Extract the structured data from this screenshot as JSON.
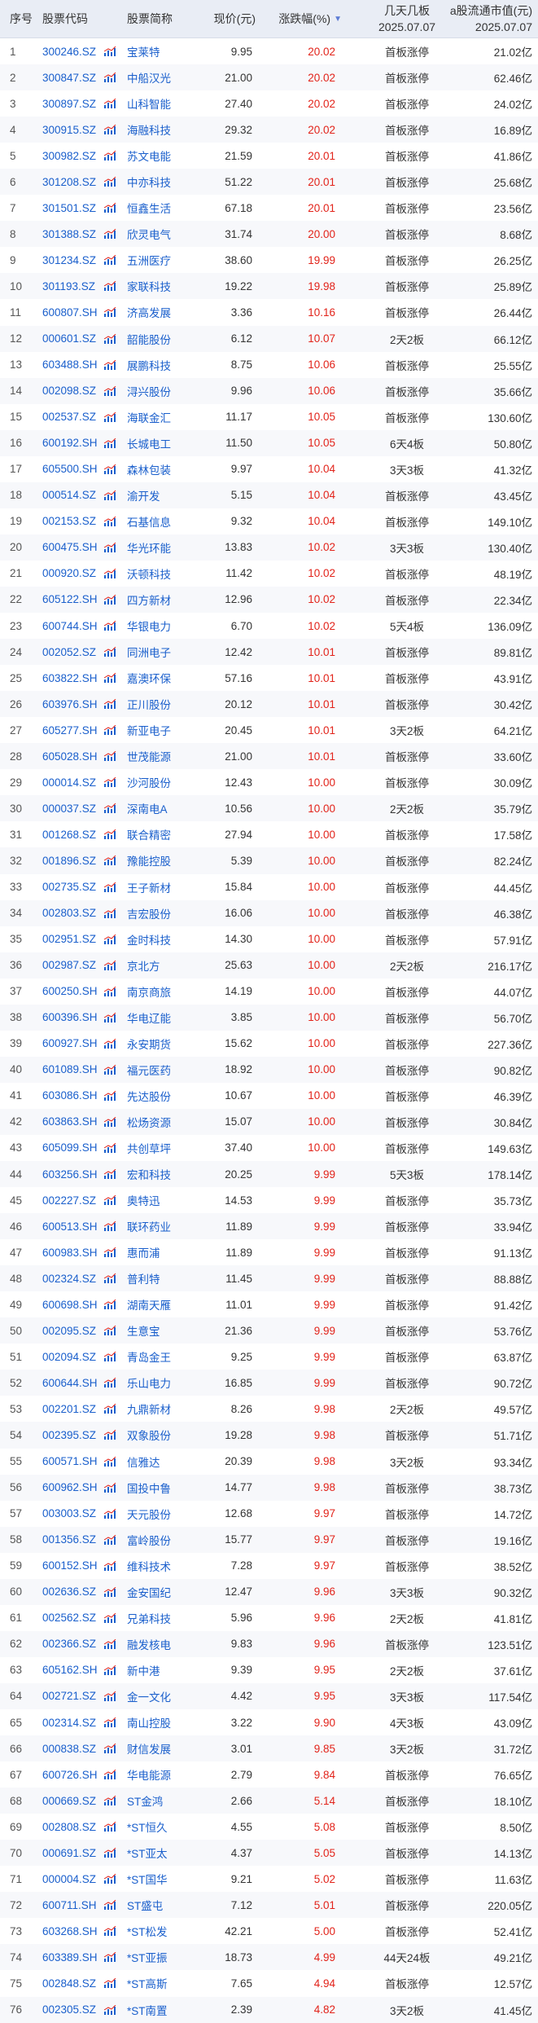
{
  "header": {
    "idx": "序号",
    "code": "股票代码",
    "name": "股票简称",
    "price": "现价(元)",
    "change": "涨跌幅(%)",
    "sort_icon": "▼",
    "board": "几天几板",
    "board_date": "2025.07.07",
    "cap": "a股流通市值(元)",
    "cap_date": "2025.07.07"
  },
  "colors": {
    "header_bg": "#e9edf5",
    "link_blue": "#1a5fcc",
    "up_red": "#e2231a"
  },
  "rows": [
    {
      "idx": "1",
      "code": "300246.SZ",
      "name": "宝莱特",
      "price": "9.95",
      "change": "20.02",
      "board": "首板涨停",
      "cap": "21.02亿"
    },
    {
      "idx": "2",
      "code": "300847.SZ",
      "name": "中船汉光",
      "price": "21.00",
      "change": "20.02",
      "board": "首板涨停",
      "cap": "62.46亿"
    },
    {
      "idx": "3",
      "code": "300897.SZ",
      "name": "山科智能",
      "price": "27.40",
      "change": "20.02",
      "board": "首板涨停",
      "cap": "24.02亿"
    },
    {
      "idx": "4",
      "code": "300915.SZ",
      "name": "海融科技",
      "price": "29.32",
      "change": "20.02",
      "board": "首板涨停",
      "cap": "16.89亿"
    },
    {
      "idx": "5",
      "code": "300982.SZ",
      "name": "苏文电能",
      "price": "21.59",
      "change": "20.01",
      "board": "首板涨停",
      "cap": "41.86亿"
    },
    {
      "idx": "6",
      "code": "301208.SZ",
      "name": "中亦科技",
      "price": "51.22",
      "change": "20.01",
      "board": "首板涨停",
      "cap": "25.68亿"
    },
    {
      "idx": "7",
      "code": "301501.SZ",
      "name": "恒鑫生活",
      "price": "67.18",
      "change": "20.01",
      "board": "首板涨停",
      "cap": "23.56亿"
    },
    {
      "idx": "8",
      "code": "301388.SZ",
      "name": "欣灵电气",
      "price": "31.74",
      "change": "20.00",
      "board": "首板涨停",
      "cap": "8.68亿"
    },
    {
      "idx": "9",
      "code": "301234.SZ",
      "name": "五洲医疗",
      "price": "38.60",
      "change": "19.99",
      "board": "首板涨停",
      "cap": "26.25亿"
    },
    {
      "idx": "10",
      "code": "301193.SZ",
      "name": "家联科技",
      "price": "19.22",
      "change": "19.98",
      "board": "首板涨停",
      "cap": "25.89亿"
    },
    {
      "idx": "11",
      "code": "600807.SH",
      "name": "济高发展",
      "price": "3.36",
      "change": "10.16",
      "board": "首板涨停",
      "cap": "26.44亿"
    },
    {
      "idx": "12",
      "code": "000601.SZ",
      "name": "韶能股份",
      "price": "6.12",
      "change": "10.07",
      "board": "2天2板",
      "cap": "66.12亿"
    },
    {
      "idx": "13",
      "code": "603488.SH",
      "name": "展鹏科技",
      "price": "8.75",
      "change": "10.06",
      "board": "首板涨停",
      "cap": "25.55亿"
    },
    {
      "idx": "14",
      "code": "002098.SZ",
      "name": "浔兴股份",
      "price": "9.96",
      "change": "10.06",
      "board": "首板涨停",
      "cap": "35.66亿"
    },
    {
      "idx": "15",
      "code": "002537.SZ",
      "name": "海联金汇",
      "price": "11.17",
      "change": "10.05",
      "board": "首板涨停",
      "cap": "130.60亿"
    },
    {
      "idx": "16",
      "code": "600192.SH",
      "name": "长城电工",
      "price": "11.50",
      "change": "10.05",
      "board": "6天4板",
      "cap": "50.80亿"
    },
    {
      "idx": "17",
      "code": "605500.SH",
      "name": "森林包装",
      "price": "9.97",
      "change": "10.04",
      "board": "3天3板",
      "cap": "41.32亿"
    },
    {
      "idx": "18",
      "code": "000514.SZ",
      "name": "渝开发",
      "price": "5.15",
      "change": "10.04",
      "board": "首板涨停",
      "cap": "43.45亿"
    },
    {
      "idx": "19",
      "code": "002153.SZ",
      "name": "石基信息",
      "price": "9.32",
      "change": "10.04",
      "board": "首板涨停",
      "cap": "149.10亿"
    },
    {
      "idx": "20",
      "code": "600475.SH",
      "name": "华光环能",
      "price": "13.83",
      "change": "10.02",
      "board": "3天3板",
      "cap": "130.40亿"
    },
    {
      "idx": "21",
      "code": "000920.SZ",
      "name": "沃顿科技",
      "price": "11.42",
      "change": "10.02",
      "board": "首板涨停",
      "cap": "48.19亿"
    },
    {
      "idx": "22",
      "code": "605122.SH",
      "name": "四方新材",
      "price": "12.96",
      "change": "10.02",
      "board": "首板涨停",
      "cap": "22.34亿"
    },
    {
      "idx": "23",
      "code": "600744.SH",
      "name": "华银电力",
      "price": "6.70",
      "change": "10.02",
      "board": "5天4板",
      "cap": "136.09亿"
    },
    {
      "idx": "24",
      "code": "002052.SZ",
      "name": "同洲电子",
      "price": "12.42",
      "change": "10.01",
      "board": "首板涨停",
      "cap": "89.81亿"
    },
    {
      "idx": "25",
      "code": "603822.SH",
      "name": "嘉澳环保",
      "price": "57.16",
      "change": "10.01",
      "board": "首板涨停",
      "cap": "43.91亿"
    },
    {
      "idx": "26",
      "code": "603976.SH",
      "name": "正川股份",
      "price": "20.12",
      "change": "10.01",
      "board": "首板涨停",
      "cap": "30.42亿"
    },
    {
      "idx": "27",
      "code": "605277.SH",
      "name": "新亚电子",
      "price": "20.45",
      "change": "10.01",
      "board": "3天2板",
      "cap": "64.21亿"
    },
    {
      "idx": "28",
      "code": "605028.SH",
      "name": "世茂能源",
      "price": "21.00",
      "change": "10.01",
      "board": "首板涨停",
      "cap": "33.60亿"
    },
    {
      "idx": "29",
      "code": "000014.SZ",
      "name": "沙河股份",
      "price": "12.43",
      "change": "10.00",
      "board": "首板涨停",
      "cap": "30.09亿"
    },
    {
      "idx": "30",
      "code": "000037.SZ",
      "name": "深南电A",
      "price": "10.56",
      "change": "10.00",
      "board": "2天2板",
      "cap": "35.79亿"
    },
    {
      "idx": "31",
      "code": "001268.SZ",
      "name": "联合精密",
      "price": "27.94",
      "change": "10.00",
      "board": "首板涨停",
      "cap": "17.58亿"
    },
    {
      "idx": "32",
      "code": "001896.SZ",
      "name": "豫能控股",
      "price": "5.39",
      "change": "10.00",
      "board": "首板涨停",
      "cap": "82.24亿"
    },
    {
      "idx": "33",
      "code": "002735.SZ",
      "name": "王子新材",
      "price": "15.84",
      "change": "10.00",
      "board": "首板涨停",
      "cap": "44.45亿"
    },
    {
      "idx": "34",
      "code": "002803.SZ",
      "name": "吉宏股份",
      "price": "16.06",
      "change": "10.00",
      "board": "首板涨停",
      "cap": "46.38亿"
    },
    {
      "idx": "35",
      "code": "002951.SZ",
      "name": "金时科技",
      "price": "14.30",
      "change": "10.00",
      "board": "首板涨停",
      "cap": "57.91亿"
    },
    {
      "idx": "36",
      "code": "002987.SZ",
      "name": "京北方",
      "price": "25.63",
      "change": "10.00",
      "board": "2天2板",
      "cap": "216.17亿"
    },
    {
      "idx": "37",
      "code": "600250.SH",
      "name": "南京商旅",
      "price": "14.19",
      "change": "10.00",
      "board": "首板涨停",
      "cap": "44.07亿"
    },
    {
      "idx": "38",
      "code": "600396.SH",
      "name": "华电辽能",
      "price": "3.85",
      "change": "10.00",
      "board": "首板涨停",
      "cap": "56.70亿"
    },
    {
      "idx": "39",
      "code": "600927.SH",
      "name": "永安期货",
      "price": "15.62",
      "change": "10.00",
      "board": "首板涨停",
      "cap": "227.36亿"
    },
    {
      "idx": "40",
      "code": "601089.SH",
      "name": "福元医药",
      "price": "18.92",
      "change": "10.00",
      "board": "首板涨停",
      "cap": "90.82亿"
    },
    {
      "idx": "41",
      "code": "603086.SH",
      "name": "先达股份",
      "price": "10.67",
      "change": "10.00",
      "board": "首板涨停",
      "cap": "46.39亿"
    },
    {
      "idx": "42",
      "code": "603863.SH",
      "name": "松炀资源",
      "price": "15.07",
      "change": "10.00",
      "board": "首板涨停",
      "cap": "30.84亿"
    },
    {
      "idx": "43",
      "code": "605099.SH",
      "name": "共创草坪",
      "price": "37.40",
      "change": "10.00",
      "board": "首板涨停",
      "cap": "149.63亿"
    },
    {
      "idx": "44",
      "code": "603256.SH",
      "name": "宏和科技",
      "price": "20.25",
      "change": "9.99",
      "board": "5天3板",
      "cap": "178.14亿"
    },
    {
      "idx": "45",
      "code": "002227.SZ",
      "name": "奥特迅",
      "price": "14.53",
      "change": "9.99",
      "board": "首板涨停",
      "cap": "35.73亿"
    },
    {
      "idx": "46",
      "code": "600513.SH",
      "name": "联环药业",
      "price": "11.89",
      "change": "9.99",
      "board": "首板涨停",
      "cap": "33.94亿"
    },
    {
      "idx": "47",
      "code": "600983.SH",
      "name": "惠而浦",
      "price": "11.89",
      "change": "9.99",
      "board": "首板涨停",
      "cap": "91.13亿"
    },
    {
      "idx": "48",
      "code": "002324.SZ",
      "name": "普利特",
      "price": "11.45",
      "change": "9.99",
      "board": "首板涨停",
      "cap": "88.88亿"
    },
    {
      "idx": "49",
      "code": "600698.SH",
      "name": "湖南天雁",
      "price": "11.01",
      "change": "9.99",
      "board": "首板涨停",
      "cap": "91.42亿"
    },
    {
      "idx": "50",
      "code": "002095.SZ",
      "name": "生意宝",
      "price": "21.36",
      "change": "9.99",
      "board": "首板涨停",
      "cap": "53.76亿"
    },
    {
      "idx": "51",
      "code": "002094.SZ",
      "name": "青岛金王",
      "price": "9.25",
      "change": "9.99",
      "board": "首板涨停",
      "cap": "63.87亿"
    },
    {
      "idx": "52",
      "code": "600644.SH",
      "name": "乐山电力",
      "price": "16.85",
      "change": "9.99",
      "board": "首板涨停",
      "cap": "90.72亿"
    },
    {
      "idx": "53",
      "code": "002201.SZ",
      "name": "九鼎新材",
      "price": "8.26",
      "change": "9.98",
      "board": "2天2板",
      "cap": "49.57亿"
    },
    {
      "idx": "54",
      "code": "002395.SZ",
      "name": "双象股份",
      "price": "19.28",
      "change": "9.98",
      "board": "首板涨停",
      "cap": "51.71亿"
    },
    {
      "idx": "55",
      "code": "600571.SH",
      "name": "信雅达",
      "price": "20.39",
      "change": "9.98",
      "board": "3天2板",
      "cap": "93.34亿"
    },
    {
      "idx": "56",
      "code": "600962.SH",
      "name": "国投中鲁",
      "price": "14.77",
      "change": "9.98",
      "board": "首板涨停",
      "cap": "38.73亿"
    },
    {
      "idx": "57",
      "code": "003003.SZ",
      "name": "天元股份",
      "price": "12.68",
      "change": "9.97",
      "board": "首板涨停",
      "cap": "14.72亿"
    },
    {
      "idx": "58",
      "code": "001356.SZ",
      "name": "富岭股份",
      "price": "15.77",
      "change": "9.97",
      "board": "首板涨停",
      "cap": "19.16亿"
    },
    {
      "idx": "59",
      "code": "600152.SH",
      "name": "维科技术",
      "price": "7.28",
      "change": "9.97",
      "board": "首板涨停",
      "cap": "38.52亿"
    },
    {
      "idx": "60",
      "code": "002636.SZ",
      "name": "金安国纪",
      "price": "12.47",
      "change": "9.96",
      "board": "3天3板",
      "cap": "90.32亿"
    },
    {
      "idx": "61",
      "code": "002562.SZ",
      "name": "兄弟科技",
      "price": "5.96",
      "change": "9.96",
      "board": "2天2板",
      "cap": "41.81亿"
    },
    {
      "idx": "62",
      "code": "002366.SZ",
      "name": "融发核电",
      "price": "9.83",
      "change": "9.96",
      "board": "首板涨停",
      "cap": "123.51亿"
    },
    {
      "idx": "63",
      "code": "605162.SH",
      "name": "新中港",
      "price": "9.39",
      "change": "9.95",
      "board": "2天2板",
      "cap": "37.61亿"
    },
    {
      "idx": "64",
      "code": "002721.SZ",
      "name": "金一文化",
      "price": "4.42",
      "change": "9.95",
      "board": "3天3板",
      "cap": "117.54亿"
    },
    {
      "idx": "65",
      "code": "002314.SZ",
      "name": "南山控股",
      "price": "3.22",
      "change": "9.90",
      "board": "4天3板",
      "cap": "43.09亿"
    },
    {
      "idx": "66",
      "code": "000838.SZ",
      "name": "财信发展",
      "price": "3.01",
      "change": "9.85",
      "board": "3天2板",
      "cap": "31.72亿"
    },
    {
      "idx": "67",
      "code": "600726.SH",
      "name": "华电能源",
      "price": "2.79",
      "change": "9.84",
      "board": "首板涨停",
      "cap": "76.65亿"
    },
    {
      "idx": "68",
      "code": "000669.SZ",
      "name": "ST金鸿",
      "price": "2.66",
      "change": "5.14",
      "board": "首板涨停",
      "cap": "18.10亿"
    },
    {
      "idx": "69",
      "code": "002808.SZ",
      "name": "*ST恒久",
      "price": "4.55",
      "change": "5.08",
      "board": "首板涨停",
      "cap": "8.50亿"
    },
    {
      "idx": "70",
      "code": "000691.SZ",
      "name": "*ST亚太",
      "price": "4.37",
      "change": "5.05",
      "board": "首板涨停",
      "cap": "14.13亿"
    },
    {
      "idx": "71",
      "code": "000004.SZ",
      "name": "*ST国华",
      "price": "9.21",
      "change": "5.02",
      "board": "首板涨停",
      "cap": "11.63亿"
    },
    {
      "idx": "72",
      "code": "600711.SH",
      "name": "ST盛屯",
      "price": "7.12",
      "change": "5.01",
      "board": "首板涨停",
      "cap": "220.05亿"
    },
    {
      "idx": "73",
      "code": "603268.SH",
      "name": "*ST松发",
      "price": "42.21",
      "change": "5.00",
      "board": "首板涨停",
      "cap": "52.41亿"
    },
    {
      "idx": "74",
      "code": "603389.SH",
      "name": "*ST亚振",
      "price": "18.73",
      "change": "4.99",
      "board": "44天24板",
      "cap": "49.21亿"
    },
    {
      "idx": "75",
      "code": "002848.SZ",
      "name": "*ST高斯",
      "price": "7.65",
      "change": "4.94",
      "board": "首板涨停",
      "cap": "12.57亿"
    },
    {
      "idx": "76",
      "code": "002305.SZ",
      "name": "*ST南置",
      "price": "2.39",
      "change": "4.82",
      "board": "3天2板",
      "cap": "41.45亿"
    }
  ]
}
